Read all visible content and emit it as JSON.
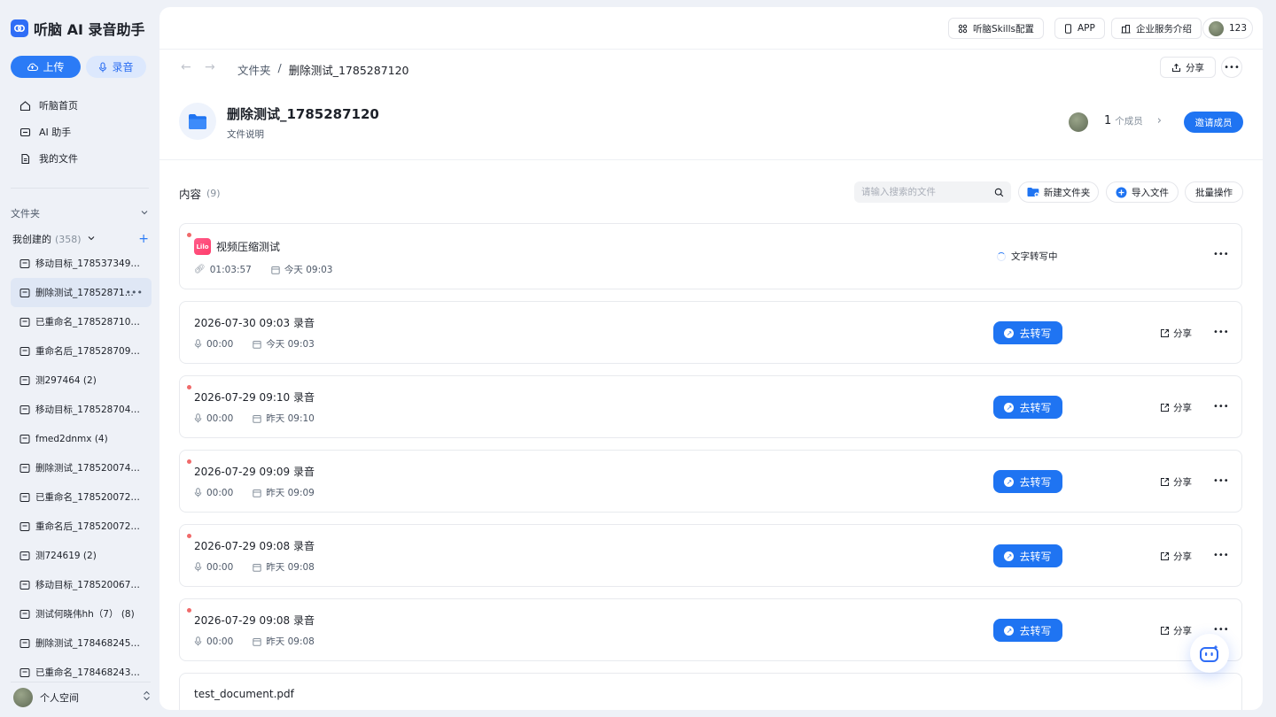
{
  "app": {
    "title": "听脑 AI 录音助手"
  },
  "sidebar": {
    "upload_label": "上传",
    "record_label": "录音",
    "nav": [
      {
        "label": "听脑首页",
        "icon": "home-icon"
      },
      {
        "label": "AI 助手",
        "icon": "chat-icon"
      },
      {
        "label": "我的文件",
        "icon": "file-icon"
      }
    ],
    "folders_title": "文件夹",
    "mine_label": "我创建的",
    "mine_count": "(358)",
    "folders": [
      "移动目标_1785373497 ...",
      "删除测试_17852871...",
      "已重命名_1785287107 (...",
      "重命名后_1785287096 ...",
      "测297464 (2)",
      "移动目标_1785287046 ...",
      "fmed2dnmx (4)",
      "删除测试_1785200743 ...",
      "已重命名_1785200729 ...",
      "重命名后_1785200720 ...",
      "测724619 (2)",
      "移动目标_1785200673 ...",
      "测试何晓伟hh（7） (8)",
      "删除测试_1784682455 ...",
      "已重命名_1784682438 ..."
    ],
    "active_index": 1,
    "user_label": "个人空间"
  },
  "topbar": {
    "skills_label": "听脑Skills配置",
    "app_label": "APP",
    "enterprise_label": "企业服务介绍",
    "user_count": "123"
  },
  "breadcrumb": {
    "root": "文件夹",
    "sep": "/",
    "current": "删除测试_1785287120"
  },
  "folder": {
    "title": "删除测试_1785287120",
    "desc": "文件说明",
    "member_count": "1",
    "member_label": "个成员",
    "invite_label": "邀请成员",
    "share_label": "分享"
  },
  "content": {
    "title": "内容",
    "count": "(9)",
    "search_placeholder": "请输入搜索的文件",
    "new_folder_label": "新建文件夹",
    "import_label": "导入文件",
    "batch_label": "批量操作",
    "transcribe_label": "去转写",
    "share_label": "分享",
    "items": [
      {
        "name": "视频压缩测试",
        "duration": "01:03:57",
        "date": "今天 09:03",
        "status": "文字转写中",
        "unread": true
      },
      {
        "name": "2026-07-30 09:03 录音",
        "duration": "00:00",
        "date": "今天 09:03",
        "unread": false
      },
      {
        "name": "2026-07-29 09:10 录音",
        "duration": "00:00",
        "date": "昨天 09:10",
        "unread": true
      },
      {
        "name": "2026-07-29 09:09 录音",
        "duration": "00:00",
        "date": "昨天 09:09",
        "unread": true
      },
      {
        "name": "2026-07-29 09:08 录音",
        "duration": "00:00",
        "date": "昨天 09:08",
        "unread": true
      },
      {
        "name": "2026-07-29 09:08 录音",
        "duration": "00:00",
        "date": "昨天 09:08",
        "unread": true
      },
      {
        "name": "test_document.pdf"
      }
    ]
  }
}
